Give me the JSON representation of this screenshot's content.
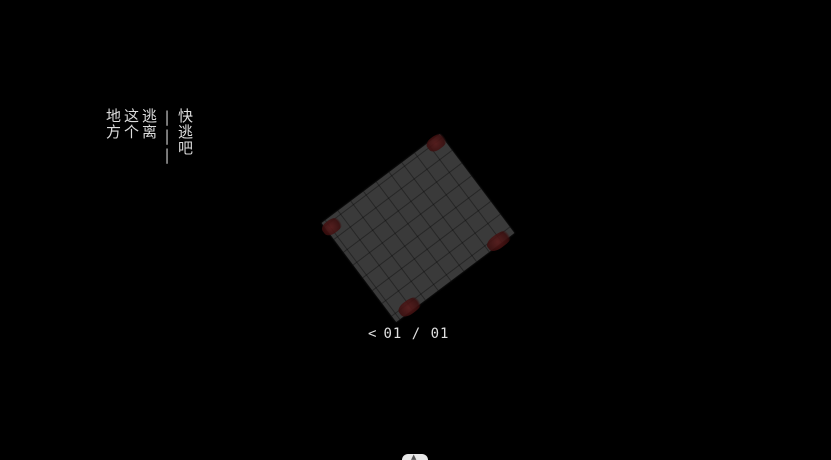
{
  "message": {
    "col_quick": "快逃吧",
    "col_sep": "|||",
    "col_1": "逃离",
    "col_2": "这个",
    "col_3": "地方"
  },
  "pager": {
    "prev_label": "<",
    "current": "01",
    "divider": "/",
    "total": "01"
  },
  "map": {
    "tile_color": "#3a3a3a",
    "stain_color": "#5a1a1a"
  },
  "bottom_handle": {
    "icon": "chevron-up-icon"
  }
}
